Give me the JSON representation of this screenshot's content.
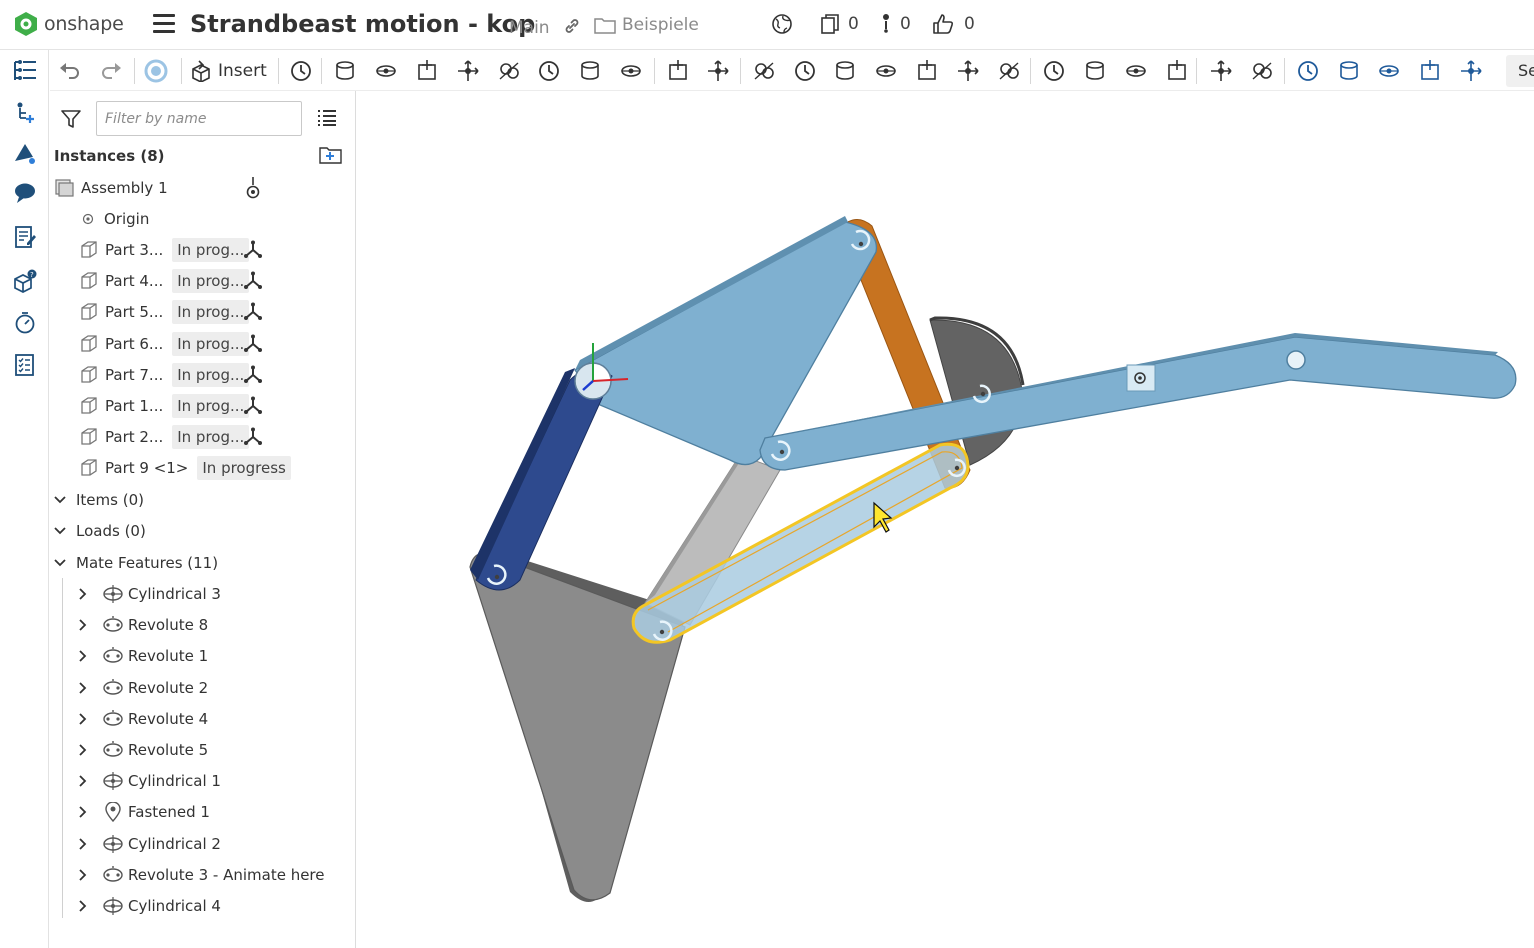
{
  "app": {
    "logo_text": "onshape",
    "document_title": "Strandbeast motion - kop",
    "branch": "Main",
    "folder": "Beispiele",
    "versions_count": "0",
    "branches_count": "0",
    "likes_count": "0",
    "accent_color": "#2f7ed8",
    "logo_color": "#3fae49"
  },
  "toolbar": {
    "insert_label": "Insert",
    "search_label": "Se"
  },
  "panel": {
    "filter_placeholder": "Filter by name",
    "instances_header": "Instances (8)",
    "assembly": "Assembly 1",
    "origin": "Origin",
    "parts": [
      {
        "name": "Part 3...",
        "status": "In prog..."
      },
      {
        "name": "Part 4...",
        "status": "In prog..."
      },
      {
        "name": "Part 5...",
        "status": "In prog..."
      },
      {
        "name": "Part 6...",
        "status": "In prog..."
      },
      {
        "name": "Part 7...",
        "status": "In prog..."
      },
      {
        "name": "Part 1...",
        "status": "In prog..."
      },
      {
        "name": "Part 2...",
        "status": "In prog..."
      },
      {
        "name": "Part 9 <1>",
        "status": "In progress"
      }
    ],
    "items_group": "Items (0)",
    "loads_group": "Loads (0)",
    "mates_group": "Mate Features (11)",
    "mates": [
      {
        "name": "Cylindrical 3",
        "type": "cylindrical"
      },
      {
        "name": "Revolute 8",
        "type": "revolute"
      },
      {
        "name": "Revolute 1",
        "type": "revolute"
      },
      {
        "name": "Revolute 2",
        "type": "revolute"
      },
      {
        "name": "Revolute 4",
        "type": "revolute"
      },
      {
        "name": "Revolute 5",
        "type": "revolute"
      },
      {
        "name": "Cylindrical 1",
        "type": "cylindrical"
      },
      {
        "name": "Fastened 1",
        "type": "fastened"
      },
      {
        "name": "Cylindrical 2",
        "type": "cylindrical"
      },
      {
        "name": "Revolute 3 - Animate here",
        "type": "revolute"
      },
      {
        "name": "Cylindrical 4",
        "type": "cylindrical"
      }
    ]
  },
  "viewport": {
    "colors": {
      "light_blue": "#7fb0d0",
      "dark_blue": "#2e4a8e",
      "orange": "#c8741e",
      "gray": "#8c8c8c",
      "dark_gray": "#5c5c5c",
      "light_gray": "#bcbcbc",
      "highlight": "#f3c624"
    }
  }
}
